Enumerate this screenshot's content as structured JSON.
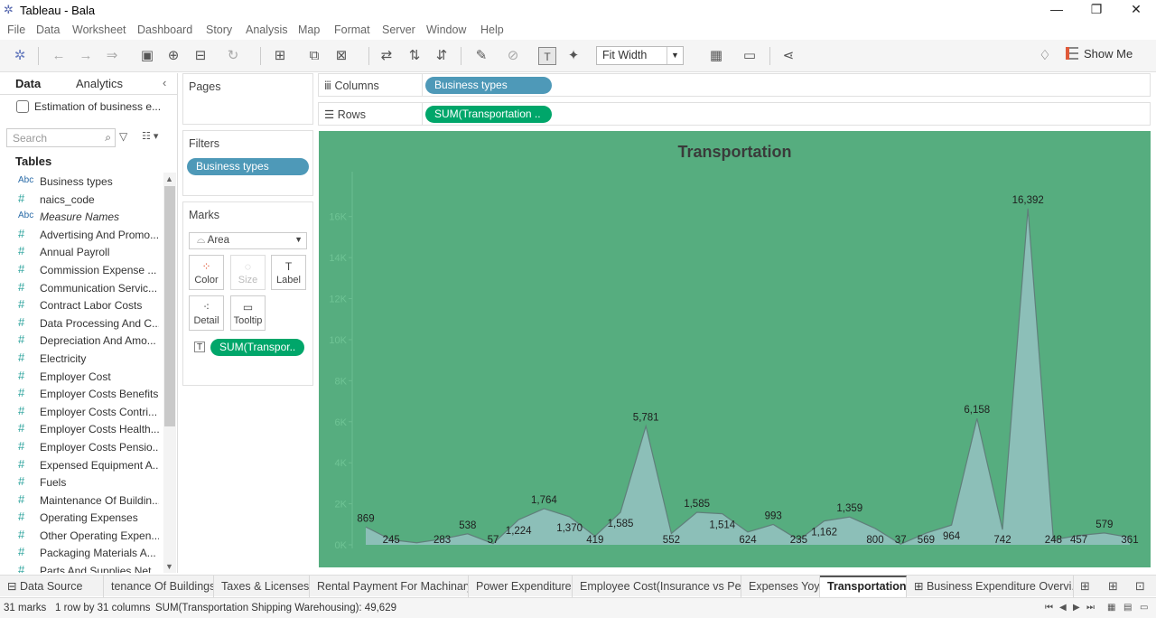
{
  "window": {
    "title": "Tableau - Bala"
  },
  "menu": [
    "File",
    "Data",
    "Worksheet",
    "Dashboard",
    "Story",
    "Analysis",
    "Map",
    "Format",
    "Server",
    "Window",
    "Help"
  ],
  "toolbar": {
    "fit_label": "Fit Width",
    "show_me_label": "Show Me"
  },
  "data_pane": {
    "tabs": [
      "Data",
      "Analytics"
    ],
    "datasource": "Estimation of business e...",
    "search_placeholder": "Search",
    "tables_header": "Tables",
    "fields": [
      {
        "type": "Abc",
        "name": "Business types"
      },
      {
        "type": "#",
        "name": "naics_code"
      },
      {
        "type": "Abc",
        "name": "Measure Names",
        "italic": true
      },
      {
        "type": "#",
        "name": "Advertising And Promo..."
      },
      {
        "type": "#",
        "name": "Annual Payroll"
      },
      {
        "type": "#",
        "name": "Commission Expense ..."
      },
      {
        "type": "#",
        "name": "Communication Servic..."
      },
      {
        "type": "#",
        "name": "Contract Labor Costs"
      },
      {
        "type": "#",
        "name": "Data Processing And C..."
      },
      {
        "type": "#",
        "name": "Depreciation And Amo..."
      },
      {
        "type": "#",
        "name": "Electricity"
      },
      {
        "type": "#",
        "name": "Employer Cost"
      },
      {
        "type": "#",
        "name": "Employer Costs Benefits"
      },
      {
        "type": "#",
        "name": "Employer Costs Contri..."
      },
      {
        "type": "#",
        "name": "Employer Costs Health..."
      },
      {
        "type": "#",
        "name": "Employer Costs Pensio..."
      },
      {
        "type": "#",
        "name": "Expensed Equipment A..."
      },
      {
        "type": "#",
        "name": "Fuels"
      },
      {
        "type": "#",
        "name": "Maintenance Of Buildin..."
      },
      {
        "type": "#",
        "name": "Operating Expenses"
      },
      {
        "type": "#",
        "name": "Other Operating Expen..."
      },
      {
        "type": "#",
        "name": "Packaging Materials A..."
      },
      {
        "type": "#",
        "name": "Parts And Supplies Net"
      }
    ]
  },
  "cards": {
    "pages_title": "Pages",
    "filters_title": "Filters",
    "filter_pill": "Business types",
    "marks_title": "Marks",
    "mark_type": "Area",
    "mark_buttons": [
      "Color",
      "Size",
      "Label",
      "Detail",
      "Tooltip"
    ],
    "mark_pill": "SUM(Transpor.."
  },
  "shelves": {
    "columns_label": "Columns",
    "columns_pill": "Business types",
    "rows_label": "Rows",
    "rows_pill": "SUM(Transportation .."
  },
  "chart_data": {
    "type": "area",
    "title": "Transportation",
    "ylim": [
      0,
      17000
    ],
    "y_ticks": [
      "0K",
      "2K",
      "4K",
      "6K",
      "8K",
      "10K",
      "12K",
      "14K",
      "16K"
    ],
    "values": [
      869,
      245,
      100,
      283,
      538,
      57,
      1224,
      1764,
      1370,
      419,
      1585,
      5781,
      552,
      1585,
      1514,
      624,
      993,
      235,
      1162,
      1359,
      800,
      37,
      569,
      964,
      6158,
      742,
      16392,
      248,
      457,
      579,
      361
    ],
    "labels": [
      "869",
      "245",
      "",
      "283",
      "538",
      "57",
      "1,224",
      "1,764",
      "1,370",
      "419",
      "1,585",
      "5,781",
      "552",
      "1,585",
      "1,514",
      "624",
      "993",
      "235",
      "1,162",
      "1,359",
      "800",
      "37",
      "569",
      "964",
      "6,158",
      "742",
      "16,392",
      "248",
      "457",
      "579",
      "361"
    ]
  },
  "sheet_tabs": [
    "Data Source",
    "tenance Of Buildings",
    "Taxes & Licenses",
    "Rental Payment For Machinary",
    "Power Expenditure",
    "Employee Cost(Insurance vs Pe...",
    "Expenses Yoy",
    "Transportation",
    "Business Expenditure Overvi..."
  ],
  "status": {
    "marks": "31 marks",
    "dims": "1 row by 31 columns",
    "sum": "SUM(Transportation Shipping Warehousing): 49,629"
  },
  "colors": {
    "viz_bg": "#56ad7f",
    "area_fill": "#8cbfb8",
    "pill_blue": "#4e99b8",
    "pill_green": "#00a66a"
  }
}
